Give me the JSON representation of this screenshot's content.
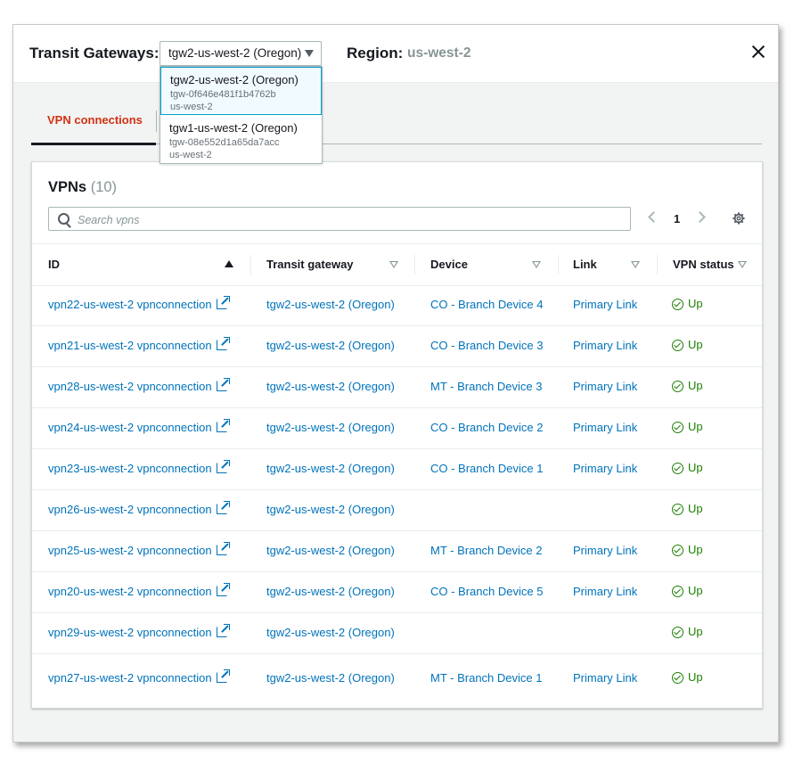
{
  "header": {
    "label": "Transit Gateways:",
    "selected_gateway": "tgw2-us-west-2 (Oregon)",
    "region_label": "Region:",
    "region_value": "us-west-2"
  },
  "dropdown": {
    "options": [
      {
        "name": "tgw2-us-west-2 (Oregon)",
        "id": "tgw-0f646e481f1b4762b",
        "region": "us-west-2",
        "selected": true
      },
      {
        "name": "tgw1-us-west-2 (Oregon)",
        "id": "tgw-08e552d1a65da7acc",
        "region": "us-west-2",
        "selected": false
      }
    ]
  },
  "tabs": [
    {
      "label": "VPN connections",
      "active": true
    }
  ],
  "panel": {
    "title": "VPNs",
    "count": "(10)",
    "search_placeholder": "Search vpns",
    "page": "1"
  },
  "table": {
    "columns": [
      "ID",
      "Transit gateway",
      "Device",
      "Link",
      "VPN status"
    ],
    "rows": [
      {
        "id": "vpn22-us-west-2 vpnconnection",
        "tgw": "tgw2-us-west-2 (Oregon)",
        "device": "CO - Branch Device 4",
        "link": "Primary Link",
        "status": "Up"
      },
      {
        "id": "vpn21-us-west-2 vpnconnection",
        "tgw": "tgw2-us-west-2 (Oregon)",
        "device": "CO - Branch Device 3",
        "link": "Primary Link",
        "status": "Up"
      },
      {
        "id": "vpn28-us-west-2 vpnconnection",
        "tgw": "tgw2-us-west-2 (Oregon)",
        "device": "MT - Branch Device 3",
        "link": "Primary Link",
        "status": "Up"
      },
      {
        "id": "vpn24-us-west-2 vpnconnection",
        "tgw": "tgw2-us-west-2 (Oregon)",
        "device": "CO - Branch Device 2",
        "link": "Primary Link",
        "status": "Up"
      },
      {
        "id": "vpn23-us-west-2 vpnconnection",
        "tgw": "tgw2-us-west-2 (Oregon)",
        "device": "CO - Branch Device 1",
        "link": "Primary Link",
        "status": "Up"
      },
      {
        "id": "vpn26-us-west-2 vpnconnection",
        "tgw": "tgw2-us-west-2 (Oregon)",
        "device": "",
        "link": "",
        "status": "Up"
      },
      {
        "id": "vpn25-us-west-2 vpnconnection",
        "tgw": "tgw2-us-west-2 (Oregon)",
        "device": "MT - Branch Device 2",
        "link": "Primary Link",
        "status": "Up"
      },
      {
        "id": "vpn20-us-west-2 vpnconnection",
        "tgw": "tgw2-us-west-2 (Oregon)",
        "device": "CO - Branch Device 5",
        "link": "Primary Link",
        "status": "Up"
      },
      {
        "id": "vpn29-us-west-2 vpnconnection",
        "tgw": "tgw2-us-west-2 (Oregon)",
        "device": "",
        "link": "",
        "status": "Up"
      },
      {
        "id": "vpn27-us-west-2 vpnconnection",
        "tgw": "tgw2-us-west-2 (Oregon)",
        "device": "MT - Branch Device 1",
        "link": "Primary Link",
        "status": "Up"
      }
    ]
  },
  "colors": {
    "link": "#0073bb",
    "status_up": "#1d8102",
    "active_tab": "#d13212"
  },
  "icons": {
    "search": "search-icon",
    "settings": "gear-icon",
    "external": "external-link-icon",
    "status": "check-circle-icon",
    "close": "close-icon"
  }
}
